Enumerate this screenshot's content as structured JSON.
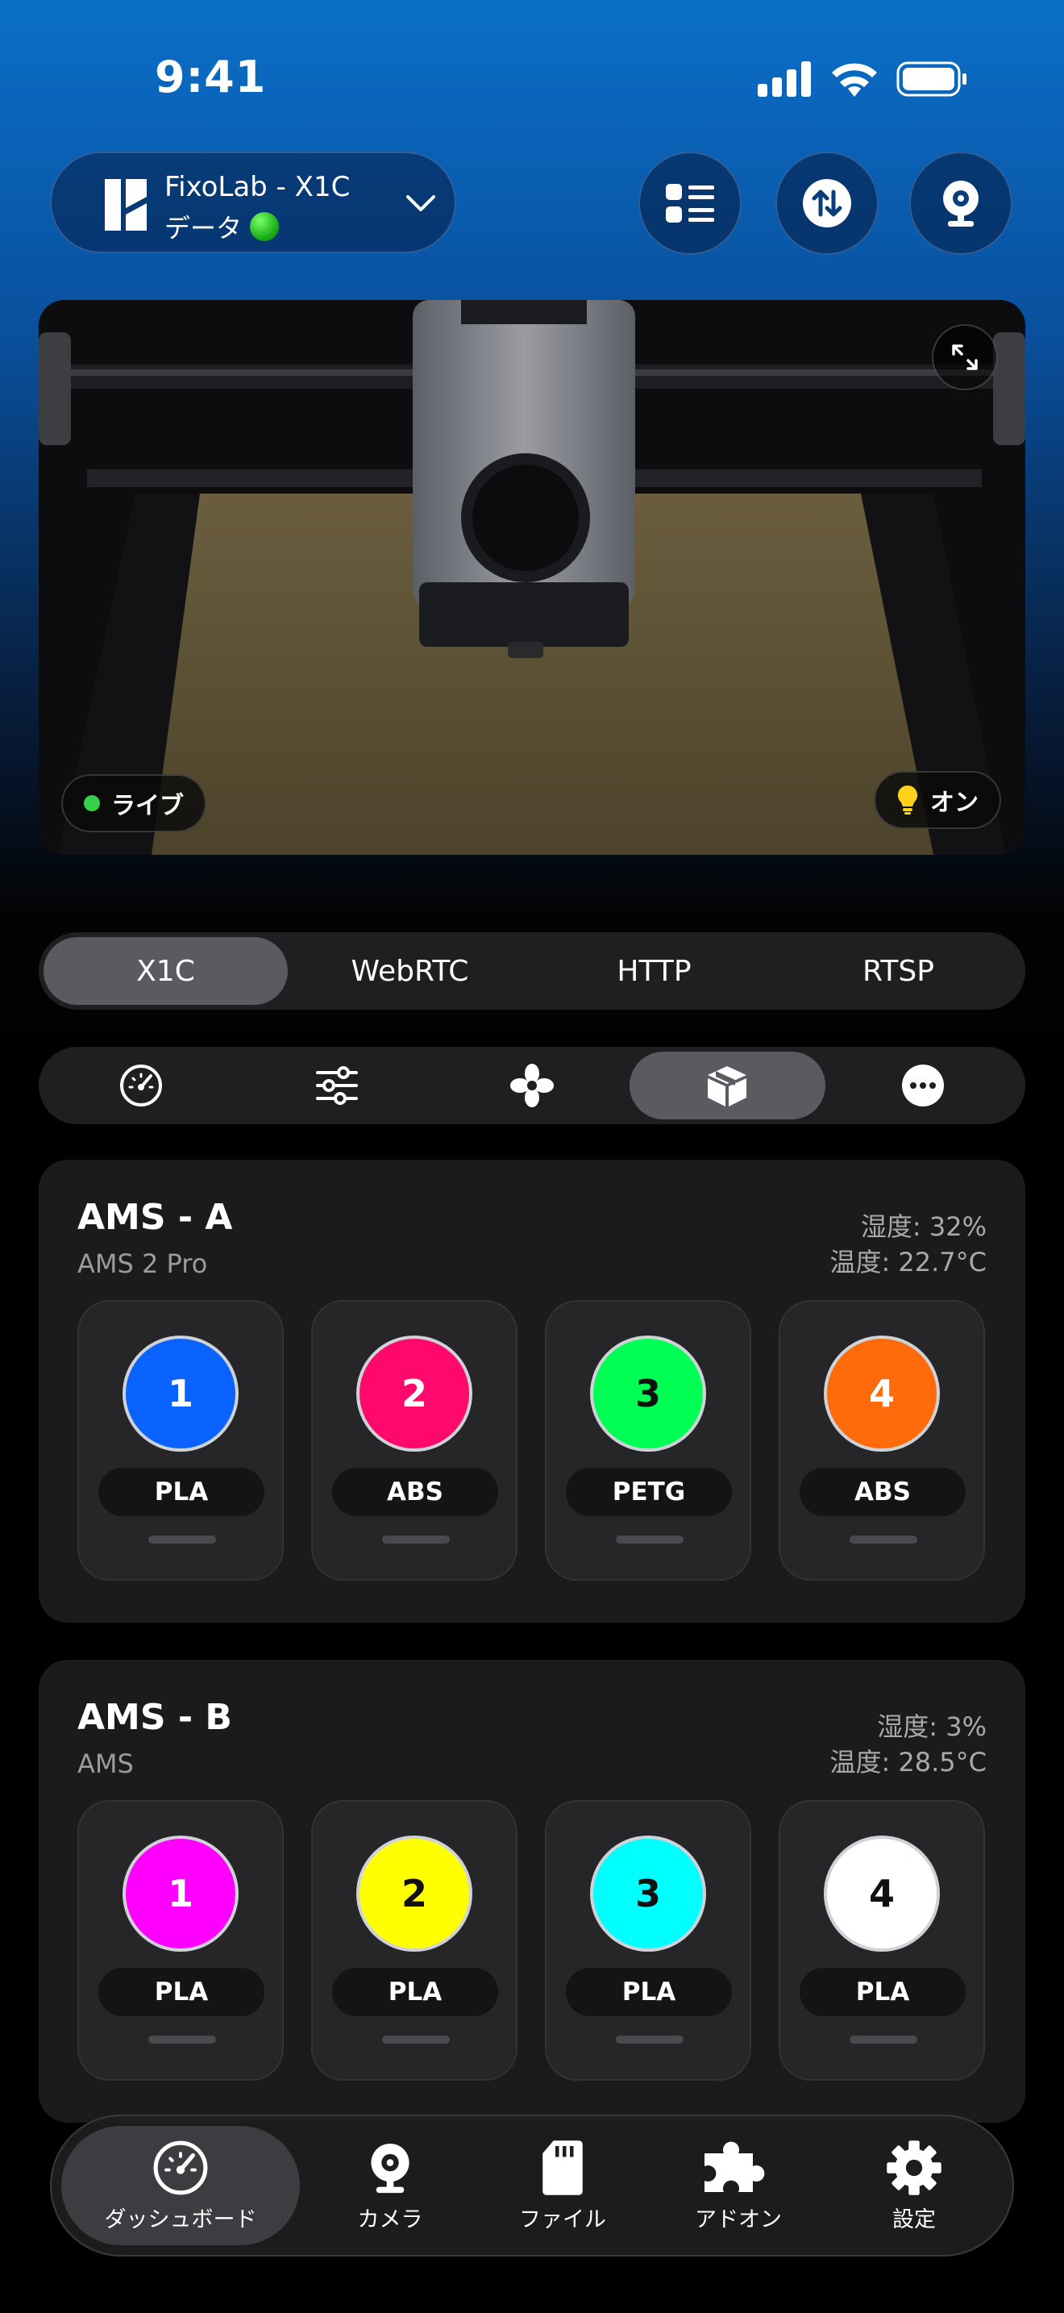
{
  "status_bar": {
    "time": "9:41"
  },
  "header": {
    "printer_name": "FixoLab - X1C",
    "printer_sub": "データ",
    "buttons": [
      "list-icon",
      "transfer-icon",
      "camera-icon"
    ]
  },
  "camera": {
    "live_label": "ライブ",
    "light_label": "オン"
  },
  "stream_tabs": [
    {
      "label": "X1C",
      "active": true
    },
    {
      "label": "WebRTC",
      "active": false
    },
    {
      "label": "HTTP",
      "active": false
    },
    {
      "label": "RTSP",
      "active": false
    }
  ],
  "tool_tabs": [
    "gauge-icon",
    "sliders-icon",
    "fan-icon",
    "box-icon",
    "more-icon"
  ],
  "active_tool": "box-icon",
  "ams": [
    {
      "title": "AMS - A",
      "model": "AMS 2 Pro",
      "humidity": "湿度: 32%",
      "temperature": "温度: 22.7°C",
      "slots": [
        {
          "num": "1",
          "type": "PLA",
          "color": "#0a62ff",
          "text_color": "#ffffff"
        },
        {
          "num": "2",
          "type": "ABS",
          "color": "#ff0a6c",
          "text_color": "#ffffff"
        },
        {
          "num": "3",
          "type": "PETG",
          "color": "#00ff55",
          "text_color": "#111111"
        },
        {
          "num": "4",
          "type": "ABS",
          "color": "#ff6a0a",
          "text_color": "#ffffff"
        }
      ]
    },
    {
      "title": "AMS - B",
      "model": "AMS",
      "humidity": "湿度: 3%",
      "temperature": "温度: 28.5°C",
      "slots": [
        {
          "num": "1",
          "type": "PLA",
          "color": "#ff00ff",
          "text_color": "#ffffff"
        },
        {
          "num": "2",
          "type": "PLA",
          "color": "#ffff00",
          "text_color": "#111111"
        },
        {
          "num": "3",
          "type": "PLA",
          "color": "#00ffff",
          "text_color": "#111111"
        },
        {
          "num": "4",
          "type": "PLA",
          "color": "#ffffff",
          "text_color": "#111111"
        }
      ]
    }
  ],
  "tabbar": [
    {
      "label": "ダッシュボード",
      "icon": "gauge-icon",
      "active": true
    },
    {
      "label": "カメラ",
      "icon": "webcam-icon",
      "active": false
    },
    {
      "label": "ファイル",
      "icon": "sdcard-icon",
      "active": false
    },
    {
      "label": "アドオン",
      "icon": "puzzle-icon",
      "active": false
    },
    {
      "label": "設定",
      "icon": "gear-icon",
      "active": false
    }
  ]
}
